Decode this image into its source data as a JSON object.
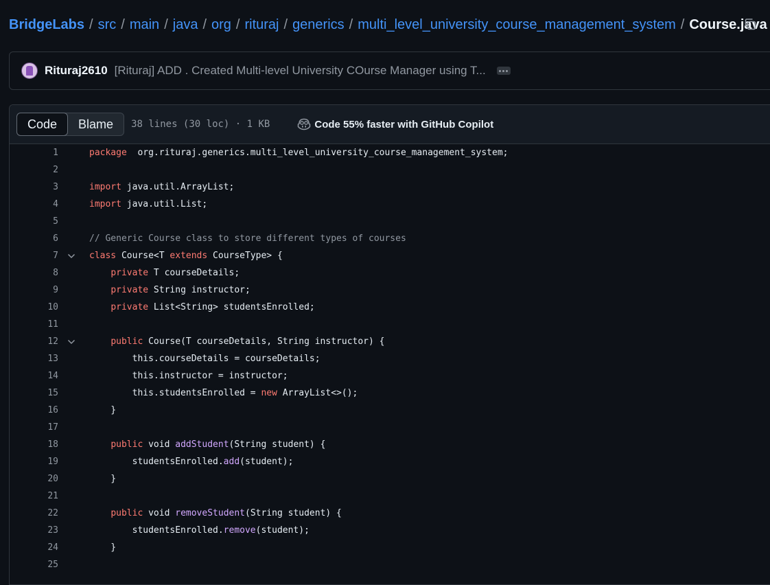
{
  "breadcrumb": {
    "segments": [
      "BridgeLabs",
      "src",
      "main",
      "java",
      "org",
      "rituraj",
      "generics",
      "multi_level_university_course_management_system"
    ],
    "separator": "/",
    "current": "Course.java"
  },
  "commit": {
    "author": "Rituraj2610",
    "message": "[Rituraj] ADD . Created Multi-level University COurse Manager using T..."
  },
  "file_header": {
    "tabs": [
      "Code",
      "Blame"
    ],
    "active_tab": "Code",
    "meta": "38 lines (30 loc) · 1 KB",
    "copilot_label": "Code 55% faster with GitHub Copilot"
  },
  "code": {
    "lines": [
      {
        "n": "1",
        "t": [
          [
            "k",
            "package"
          ],
          [
            "",
            "  org.rituraj.generics.multi_level_university_course_management_system;"
          ]
        ]
      },
      {
        "n": "2",
        "t": []
      },
      {
        "n": "3",
        "t": [
          [
            "k",
            "import"
          ],
          [
            "",
            " java.util.ArrayList;"
          ]
        ]
      },
      {
        "n": "4",
        "t": [
          [
            "k",
            "import"
          ],
          [
            "",
            " java.util.List;"
          ]
        ]
      },
      {
        "n": "5",
        "t": []
      },
      {
        "n": "6",
        "t": [
          [
            "c",
            "// Generic Course class to store different types of courses"
          ]
        ]
      },
      {
        "n": "7",
        "fold": true,
        "t": [
          [
            "k",
            "class"
          ],
          [
            "",
            " Course<T "
          ],
          [
            "k",
            "extends"
          ],
          [
            "",
            " CourseType> {"
          ]
        ]
      },
      {
        "n": "8",
        "t": [
          [
            "",
            "    "
          ],
          [
            "k",
            "private"
          ],
          [
            "",
            " T courseDetails;"
          ]
        ]
      },
      {
        "n": "9",
        "t": [
          [
            "",
            "    "
          ],
          [
            "k",
            "private"
          ],
          [
            "",
            " String instructor;"
          ]
        ]
      },
      {
        "n": "10",
        "t": [
          [
            "",
            "    "
          ],
          [
            "k",
            "private"
          ],
          [
            "",
            " List<String> studentsEnrolled;"
          ]
        ]
      },
      {
        "n": "11",
        "t": []
      },
      {
        "n": "12",
        "fold": true,
        "t": [
          [
            "",
            "    "
          ],
          [
            "k",
            "public"
          ],
          [
            "",
            " Course(T courseDetails, String instructor) {"
          ]
        ]
      },
      {
        "n": "13",
        "t": [
          [
            "",
            "        this.courseDetails = courseDetails;"
          ]
        ]
      },
      {
        "n": "14",
        "t": [
          [
            "",
            "        this.instructor = instructor;"
          ]
        ]
      },
      {
        "n": "15",
        "t": [
          [
            "",
            "        this.studentsEnrolled = "
          ],
          [
            "k",
            "new"
          ],
          [
            "",
            " ArrayList<>();"
          ]
        ]
      },
      {
        "n": "16",
        "t": [
          [
            "",
            "    }"
          ]
        ]
      },
      {
        "n": "17",
        "t": []
      },
      {
        "n": "18",
        "t": [
          [
            "",
            "    "
          ],
          [
            "k",
            "public"
          ],
          [
            "",
            " void "
          ],
          [
            "f",
            "addStudent"
          ],
          [
            "",
            "(String student) {"
          ]
        ]
      },
      {
        "n": "19",
        "t": [
          [
            "",
            "        studentsEnrolled."
          ],
          [
            "f",
            "add"
          ],
          [
            "",
            "(student);"
          ]
        ]
      },
      {
        "n": "20",
        "t": [
          [
            "",
            "    }"
          ]
        ]
      },
      {
        "n": "21",
        "t": []
      },
      {
        "n": "22",
        "t": [
          [
            "",
            "    "
          ],
          [
            "k",
            "public"
          ],
          [
            "",
            " void "
          ],
          [
            "f",
            "removeStudent"
          ],
          [
            "",
            "(String student) {"
          ]
        ]
      },
      {
        "n": "23",
        "t": [
          [
            "",
            "        studentsEnrolled."
          ],
          [
            "f",
            "remove"
          ],
          [
            "",
            "(student);"
          ]
        ]
      },
      {
        "n": "24",
        "t": [
          [
            "",
            "    }"
          ]
        ]
      },
      {
        "n": "25",
        "t": []
      }
    ]
  }
}
